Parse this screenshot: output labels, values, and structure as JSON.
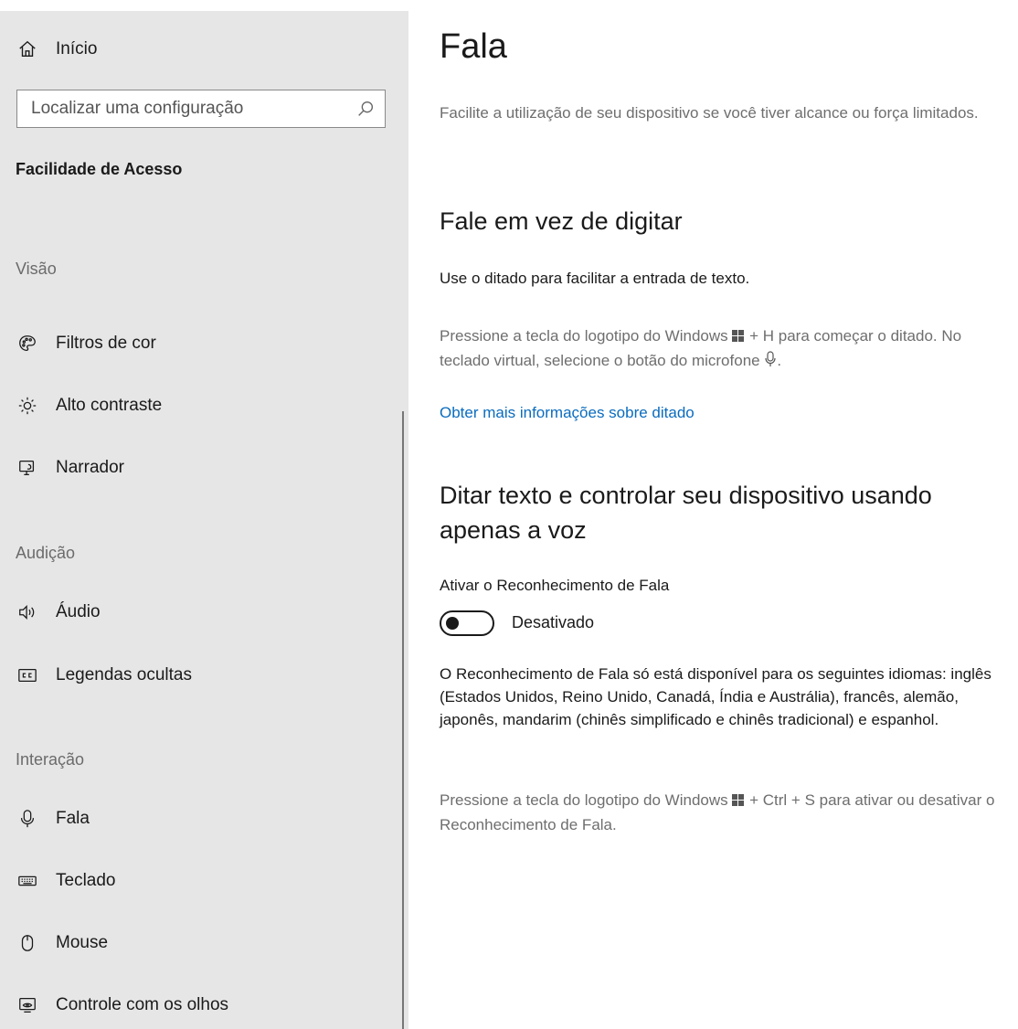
{
  "sidebar": {
    "home_label": "Início",
    "search_placeholder": "Localizar uma configuração",
    "section_title": "Facilidade de Acesso",
    "groups": [
      {
        "label": "Visão",
        "items": [
          {
            "label": "Filtros de cor",
            "icon": "palette-icon"
          },
          {
            "label": "Alto contraste",
            "icon": "sun-icon"
          },
          {
            "label": "Narrador",
            "icon": "narrator-icon"
          }
        ]
      },
      {
        "label": "Audição",
        "items": [
          {
            "label": "Áudio",
            "icon": "speaker-icon"
          },
          {
            "label": "Legendas ocultas",
            "icon": "closed-captions-icon"
          }
        ]
      },
      {
        "label": "Interação",
        "items": [
          {
            "label": "Fala",
            "icon": "microphone-icon"
          },
          {
            "label": "Teclado",
            "icon": "keyboard-icon"
          },
          {
            "label": "Mouse",
            "icon": "mouse-icon"
          },
          {
            "label": "Controle com os olhos",
            "icon": "eye-control-icon"
          }
        ]
      }
    ]
  },
  "main": {
    "title": "Fala",
    "description": "Facilite a utilização de seu dispositivo se você tiver alcance ou força limitados.",
    "dictation": {
      "heading": "Fale em vez de digitar",
      "intro": "Use o ditado para facilitar a entrada de texto.",
      "hint_part1": "Pressione a tecla do logotipo do Windows",
      "hint_part2": "+ H para começar o ditado. No teclado virtual, selecione o botão do microfone",
      "hint_part3": ".",
      "link": "Obter mais informações sobre ditado"
    },
    "speech_recognition": {
      "heading": "Ditar texto e controlar seu dispositivo usando apenas a voz",
      "toggle_label": "Ativar o Reconhecimento de Fala",
      "toggle_state": "Desativado",
      "toggle_on": false,
      "languages_note": "O Reconhecimento de Fala só está disponível para os seguintes idiomas: inglês (Estados Unidos, Reino Unido, Canadá, Índia e Austrália), francês, alemão, japonês, mandarim (chinês simplificado e chinês tradicional) e espanhol.",
      "shortcut_part1": "Pressione a tecla do logotipo do Windows",
      "shortcut_part2": "+ Ctrl + S para ativar ou desativar o Reconhecimento de Fala."
    }
  },
  "colors": {
    "sidebar_bg": "#e6e6e6",
    "link": "#0a6cbf",
    "muted_text": "#6e6e6e"
  }
}
